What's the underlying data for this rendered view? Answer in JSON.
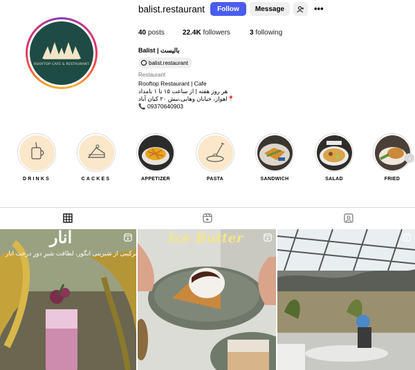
{
  "profile": {
    "username": "balist.restaurant",
    "follow_label": "Follow",
    "message_label": "Message",
    "more_label": "•••",
    "logo_text": "ROOFTOP CAFE & RESTAURANT"
  },
  "stats": {
    "posts_count": "40",
    "posts_label": "posts",
    "followers_count": "22.4K",
    "followers_label": "followers",
    "following_count": "3",
    "following_label": "following"
  },
  "bio": {
    "name": "Balist | بالیست",
    "threads_handle": "balist.restaurant",
    "category": "Restaurant",
    "line1": "Rooftop Restaurant | Cafe",
    "line2": "هر روز هفته | از ساعت ۱۵ تا ۱ بامداد",
    "line3": "اهواز، خیابان وهابی،نبش ۲۰ کیان آباد📍",
    "line4": "📞 09370640903"
  },
  "highlights": [
    {
      "label": "DRINKS",
      "icon": "drink-glass-icon"
    },
    {
      "label": "CACKES",
      "icon": "cake-slice-icon"
    },
    {
      "label": "APPETIZER",
      "icon": "fries-photo"
    },
    {
      "label": "PASTA",
      "icon": "pasta-fork-icon"
    },
    {
      "label": "SANDWICH",
      "icon": "sandwich-photo"
    },
    {
      "label": "SALAD",
      "icon": "salad-photo"
    },
    {
      "label": "FRIED",
      "icon": "fried-photo"
    }
  ],
  "tabs": [
    {
      "icon": "grid-icon",
      "active": true
    },
    {
      "icon": "reels-icon",
      "active": false
    },
    {
      "icon": "tagged-icon",
      "active": false
    }
  ],
  "posts": [
    {
      "overlay_title": "انار",
      "overlay_caption": "ترکیبی از شیرینی انگور، لطافت شیرِ دورِ درخت انار"
    },
    {
      "overlay_title": "Ice Butter"
    },
    {
      "overlay_title": ""
    }
  ],
  "colors": {
    "follow_button": "#4a5cf0",
    "avatar_bg": "#1f4b45",
    "highlight_cream": "#fbe7c9"
  }
}
